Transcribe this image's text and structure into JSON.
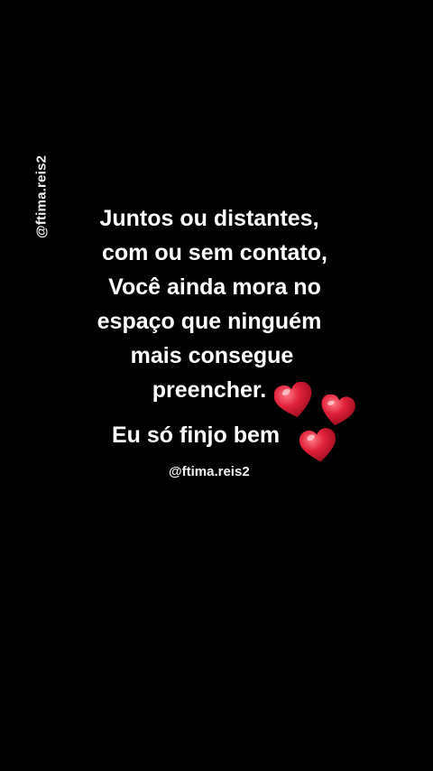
{
  "watermark_side": "@ftima.reis2",
  "quote": {
    "lines": [
      "Juntos ou distantes,",
      "com ou sem contato,",
      "Você ainda mora no",
      "espaço que ninguém",
      "mais consegue",
      "preencher."
    ]
  },
  "closing": "Eu só finjo bem",
  "watermark_bottom": "@ftima.reis2",
  "colors": {
    "background": "#000000",
    "text": "#ffffff",
    "heart": "#d8192e"
  },
  "icons": [
    "heart-icon",
    "heart-icon",
    "heart-icon"
  ]
}
